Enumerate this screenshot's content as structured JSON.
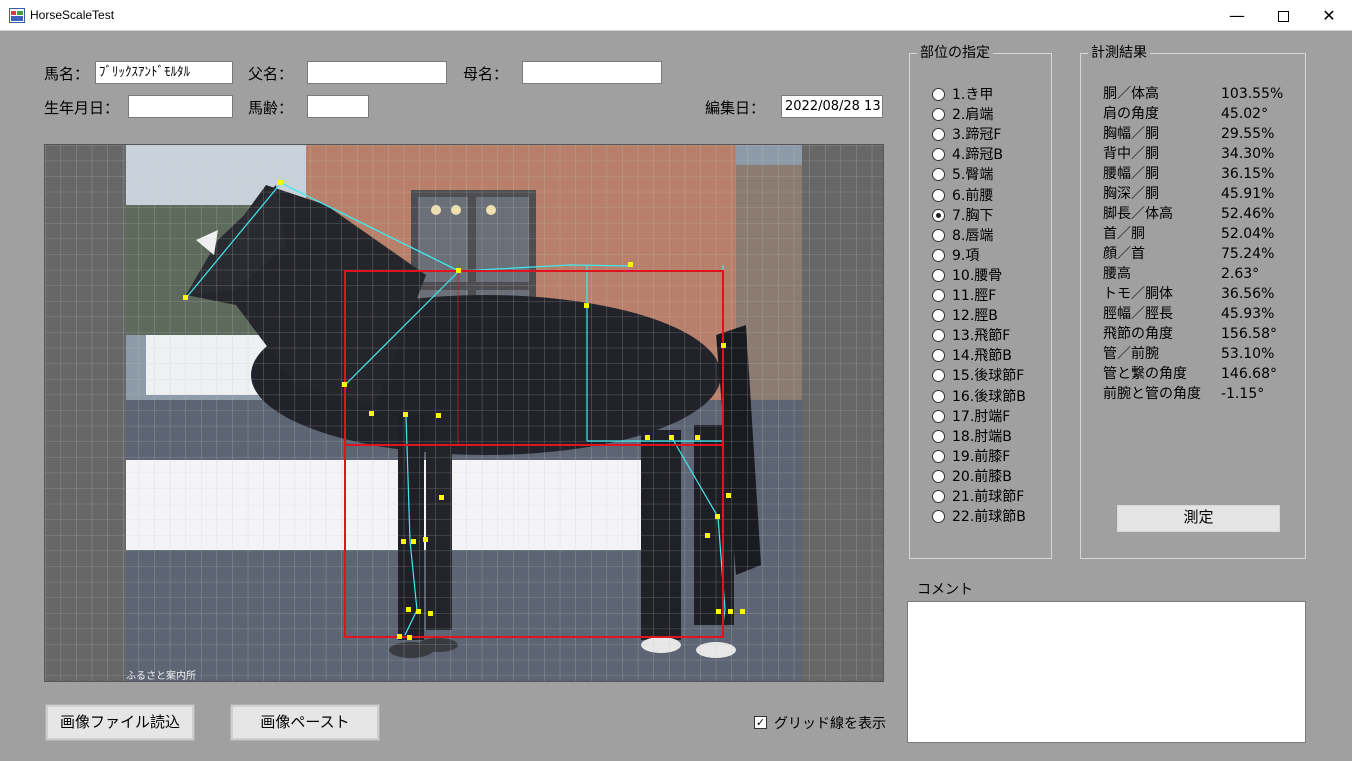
{
  "window": {
    "title": "HorseScaleTest",
    "minimize": "—",
    "close": "✕"
  },
  "form": {
    "horse_name_label": "馬名：",
    "horse_name_value": "ﾌﾞﾘｯｸｽｱﾝﾄﾞﾓﾙﾀﾙ",
    "sire_label": "父名：",
    "sire_value": "",
    "dam_label": "母名：",
    "dam_value": "",
    "birth_label": "生年月日：",
    "birth_value": "",
    "age_label": "馬齢：",
    "age_value": "",
    "edit_date_label": "編集日：",
    "edit_date_value": "2022/08/28 13"
  },
  "image": {
    "watermark": "ふるさと案内所"
  },
  "buttons": {
    "load_image": "画像ファイル読込",
    "paste_image": "画像ペースト",
    "measure": "測定"
  },
  "grid_toggle": {
    "label": "グリッド線を表示",
    "checked": true
  },
  "parts": {
    "title": "部位の指定",
    "selected_index": 6,
    "items": [
      "1.き甲",
      "2.肩端",
      "3.蹄冠F",
      "4.蹄冠B",
      "5.臀端",
      "6.前腰",
      "7.胸下",
      "8.唇端",
      "9.項",
      "10.腰骨",
      "11.脛F",
      "12.脛B",
      "13.飛節F",
      "14.飛節B",
      "15.後球節F",
      "16.後球節B",
      "17.肘端F",
      "18.肘端B",
      "19.前膝F",
      "20.前膝B",
      "21.前球節F",
      "22.前球節B"
    ]
  },
  "results": {
    "title": "計測結果",
    "rows": [
      {
        "name": "胴／体高",
        "value": "103.55%"
      },
      {
        "name": "肩の角度",
        "value": "45.02°"
      },
      {
        "name": "胸幅／胴",
        "value": "29.55%"
      },
      {
        "name": "背中／胴",
        "value": "34.30%"
      },
      {
        "name": "腰幅／胴",
        "value": "36.15%"
      },
      {
        "name": "胸深／胴",
        "value": "45.91%"
      },
      {
        "name": "脚長／体高",
        "value": "52.46%"
      },
      {
        "name": "首／胴",
        "value": "52.04%"
      },
      {
        "name": "顔／首",
        "value": "75.24%"
      },
      {
        "name": "腰高",
        "value": "2.63°"
      },
      {
        "name": "トモ／胴体",
        "value": "36.56%"
      },
      {
        "name": "脛幅／脛長",
        "value": "45.93%"
      },
      {
        "name": "飛節の角度",
        "value": "156.58°"
      },
      {
        "name": "管／前腕",
        "value": "53.10%"
      },
      {
        "name": "管と繋の角度",
        "value": "146.68°"
      },
      {
        "name": "前腕と管の角度",
        "value": "-1.15°"
      }
    ]
  },
  "comment": {
    "label": "コメント",
    "value": ""
  },
  "colors": {
    "frame_lines": "#e0141e",
    "skeleton_lines": "#40e8f0",
    "points": "#f8f800",
    "background": "#a0a0a0"
  }
}
